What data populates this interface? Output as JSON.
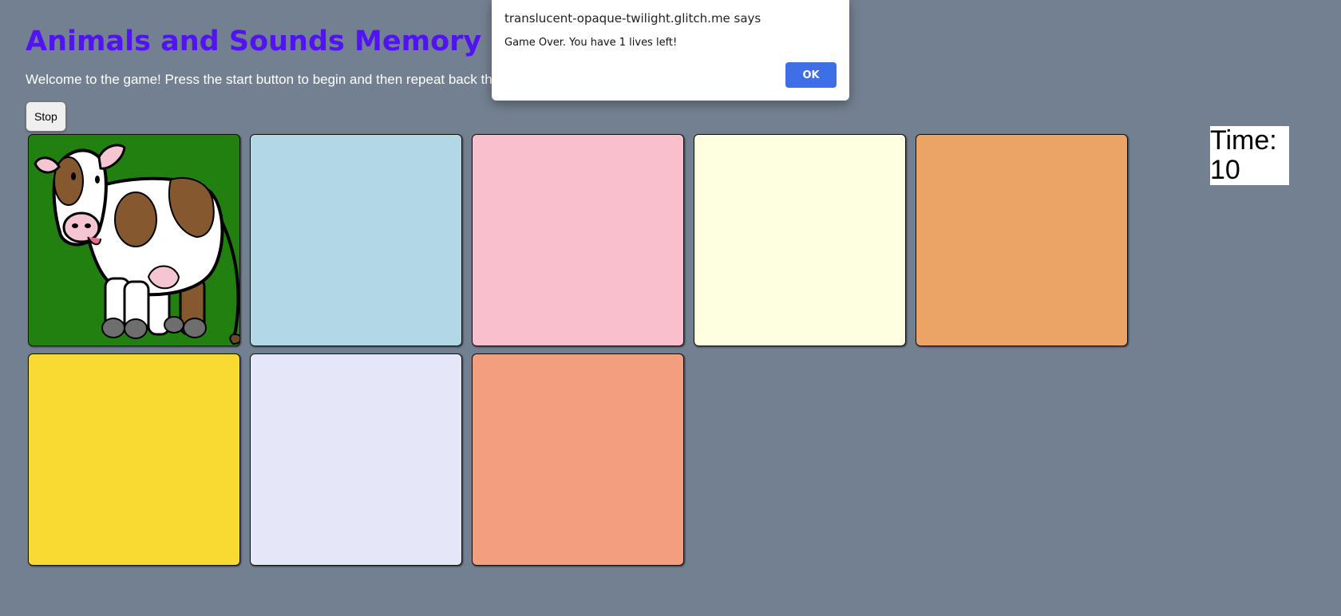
{
  "page": {
    "title": "Animals and Sounds Memory Game",
    "intro": "Welcome to the game! Press the start button to begin and then repeat back the pattern."
  },
  "controls": {
    "stop_label": "Stop"
  },
  "timer": {
    "label": "Time:",
    "value": "10"
  },
  "tiles": [
    {
      "id": 1,
      "color": "#228011",
      "image": "cow-image"
    },
    {
      "id": 2,
      "color": "#b2d8e5"
    },
    {
      "id": 3,
      "color": "#f9bfcd"
    },
    {
      "id": 4,
      "color": "#fefee1"
    },
    {
      "id": 5,
      "color": "#eba366"
    },
    {
      "id": 6,
      "color": "#f8da33"
    },
    {
      "id": 7,
      "color": "#e6e6f9"
    },
    {
      "id": 8,
      "color": "#f39f7f"
    }
  ],
  "dialog": {
    "origin": "translucent-opaque-twilight.glitch.me says",
    "message": "Game Over. You have 1 lives left!",
    "ok_label": "OK",
    "ok_color": "#3f6fe6"
  }
}
